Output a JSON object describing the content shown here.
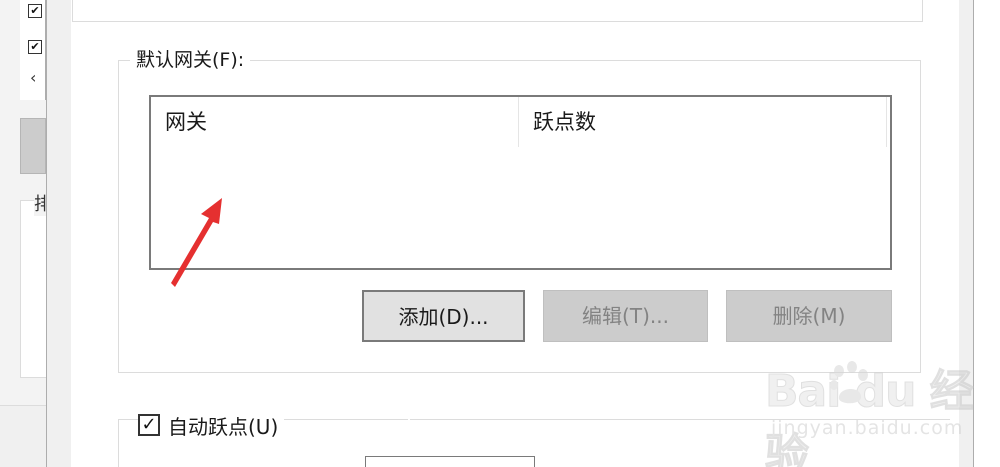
{
  "background_window": {
    "checkbox_glyph": "✔",
    "scroll_left_glyph": "‹",
    "group_glyph": "排"
  },
  "gateway_section": {
    "legend": "默认网关(F):",
    "columns": [
      "网关",
      "跃点数"
    ],
    "rows": []
  },
  "buttons": {
    "add": "添加(D)...",
    "edit": "编辑(T)...",
    "delete": "删除(M)"
  },
  "automatic_metric": {
    "label": "自动跃点(U)",
    "checked": true,
    "check_glyph": "✓"
  },
  "watermark": {
    "logo_text": "Bai du 经验",
    "site": "jingyan.baidu.com"
  },
  "colors": {
    "annotation_arrow": "#e53030",
    "disabled_text": "#838383",
    "button_face": "#e1e1e1",
    "border": "#dcdcdc"
  }
}
